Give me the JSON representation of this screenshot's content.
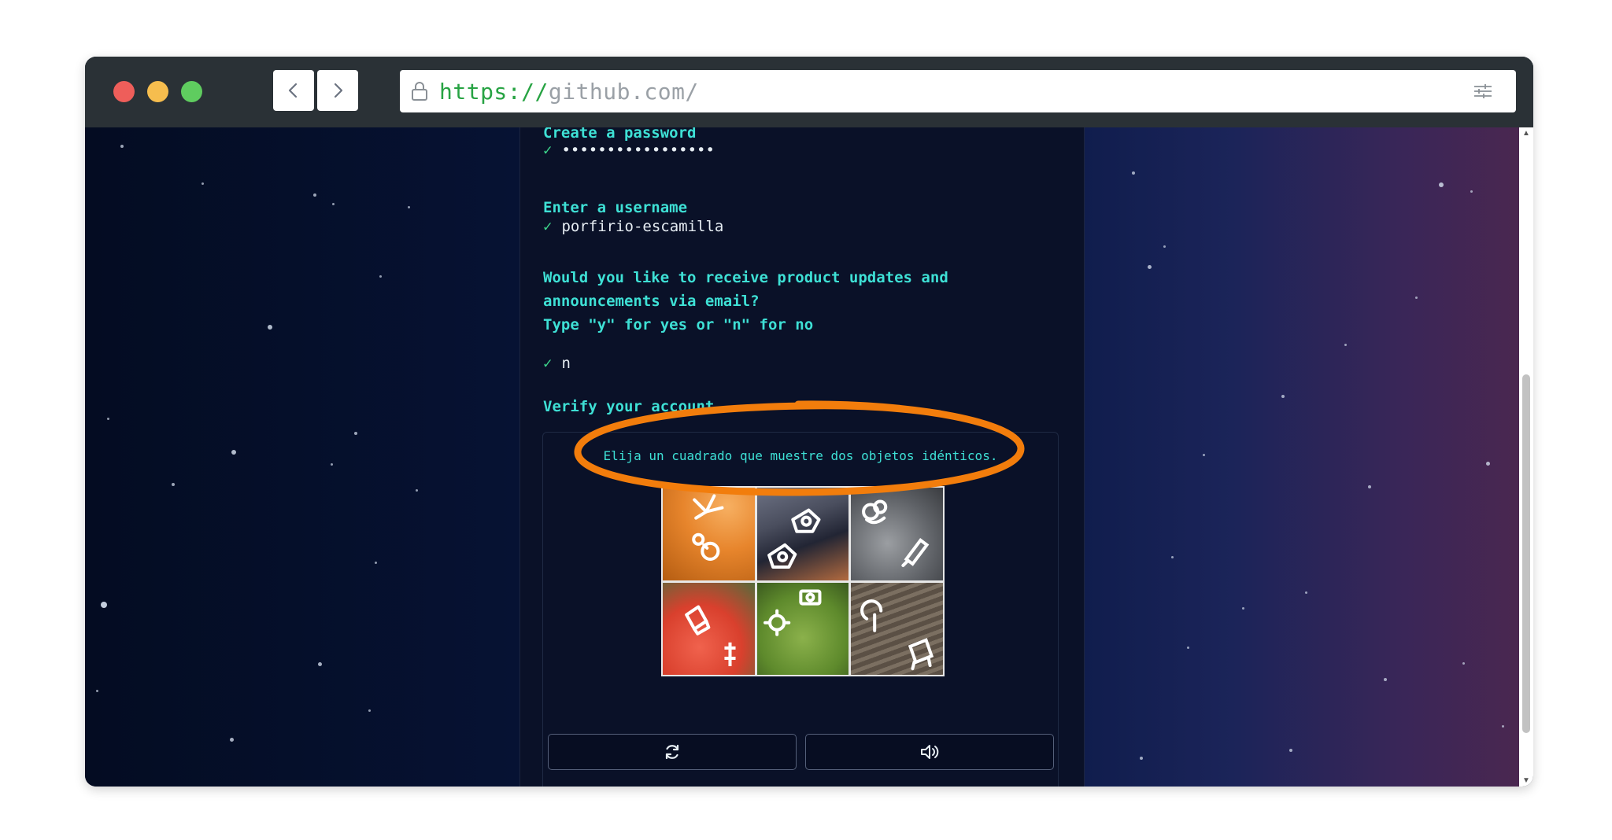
{
  "browser": {
    "url_scheme": "https://",
    "url_host": "github.com/"
  },
  "form": {
    "password_label": "Create a password",
    "password_value": "•••••••••••••••••",
    "username_label": "Enter a username",
    "username_value": "porfirio-escamilla",
    "updates_label_line1": "Would you like to receive product updates and",
    "updates_label_line2": "announcements via email?",
    "updates_label_line3": "Type \"y\" for yes or \"n\" for no",
    "updates_value": "n",
    "check_mark": "✓",
    "verify_label": "Verify your account"
  },
  "captcha": {
    "instruction": "Elija un cuadrado que muestre dos objetos idénticos.",
    "tiles": [
      "tile-1",
      "tile-2",
      "tile-3",
      "tile-4",
      "tile-5",
      "tile-6"
    ],
    "refresh_icon": "refresh-icon",
    "audio_icon": "speaker-icon"
  },
  "annotation": {
    "color": "#f27d0c"
  },
  "icons": {
    "back": "chevron-left-icon",
    "forward": "chevron-right-icon",
    "lock": "lock-icon",
    "menu": "sliders-icon"
  }
}
